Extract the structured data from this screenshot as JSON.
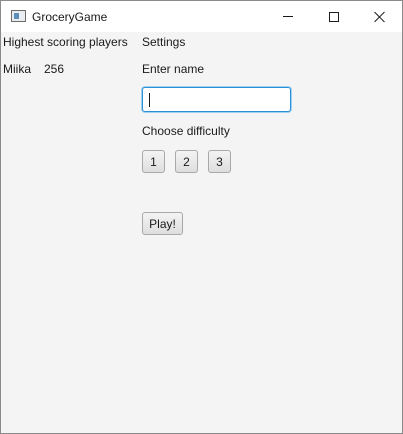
{
  "window": {
    "title": "GroceryGame"
  },
  "scoreboard": {
    "heading": "Highest scoring players",
    "players": [
      {
        "name": "Miika",
        "score": "256"
      }
    ]
  },
  "settings": {
    "heading": "Settings",
    "name_label": "Enter name",
    "name_value": "",
    "difficulty_label": "Choose difficulty",
    "difficulties": [
      "1",
      "2",
      "3"
    ],
    "play_label": "Play!"
  },
  "icons": {
    "app": "app-window-icon",
    "minimize": "minimize-icon",
    "maximize": "maximize-icon",
    "close": "close-icon"
  },
  "colors": {
    "focus_border": "#2d8fd5",
    "background": "#f4f4f4"
  }
}
